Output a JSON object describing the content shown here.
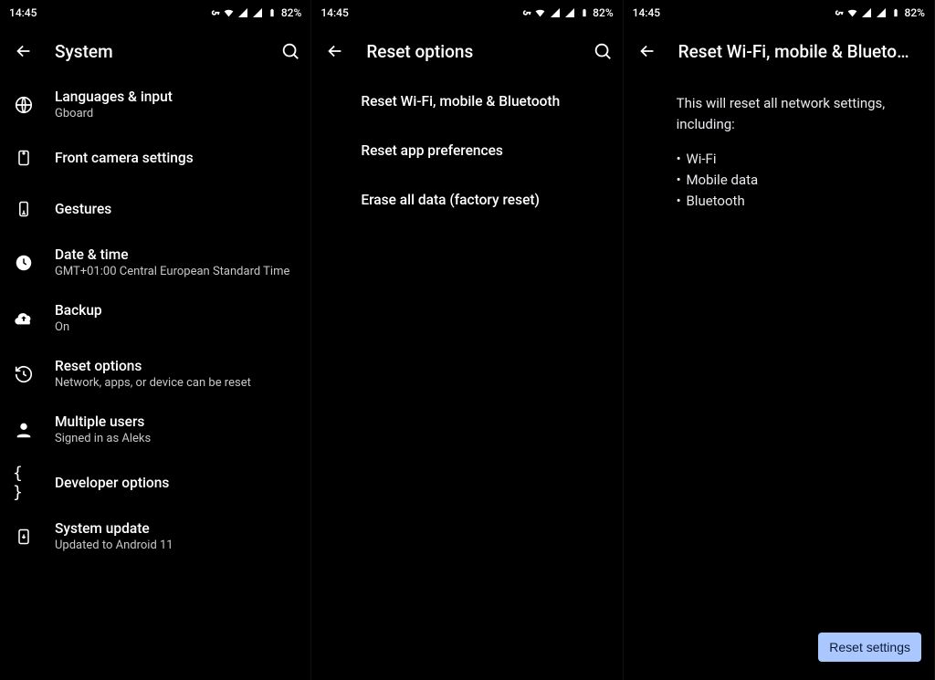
{
  "status": {
    "time": "14:45",
    "battery": "82%"
  },
  "panel1": {
    "title": "System",
    "items": [
      {
        "label": "Languages & input",
        "sub": "Gboard"
      },
      {
        "label": "Front camera settings",
        "sub": ""
      },
      {
        "label": "Gestures",
        "sub": ""
      },
      {
        "label": "Date & time",
        "sub": "GMT+01:00 Central European Standard Time"
      },
      {
        "label": "Backup",
        "sub": "On"
      },
      {
        "label": "Reset options",
        "sub": "Network, apps, or device can be reset"
      },
      {
        "label": "Multiple users",
        "sub": "Signed in as Aleks"
      },
      {
        "label": "Developer options",
        "sub": ""
      },
      {
        "label": "System update",
        "sub": "Updated to Android 11"
      }
    ]
  },
  "panel2": {
    "title": "Reset options",
    "items": [
      {
        "label": "Reset Wi-Fi, mobile & Bluetooth"
      },
      {
        "label": "Reset app preferences"
      },
      {
        "label": "Erase all data (factory reset)"
      }
    ]
  },
  "panel3": {
    "title": "Reset Wi-Fi, mobile & Blueto…",
    "description": "This will reset all network settings, including:",
    "bullets": [
      "Wi-Fi",
      "Mobile data",
      "Bluetooth"
    ],
    "button": "Reset settings"
  }
}
